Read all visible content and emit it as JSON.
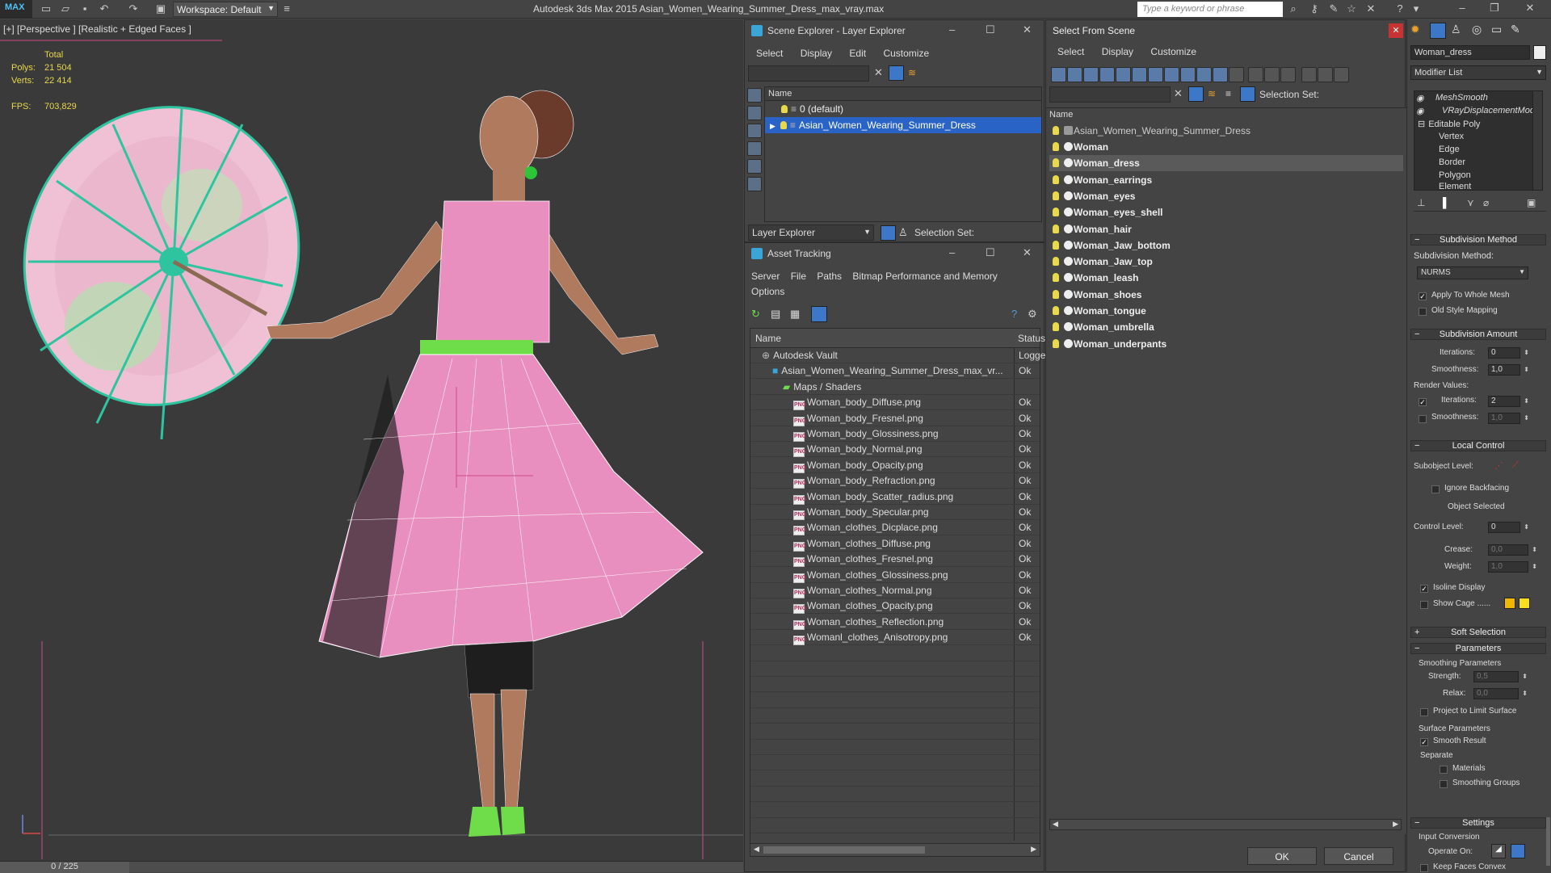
{
  "titlebar": {
    "logo": "MAX",
    "workspace_label": "Workspace: Default",
    "app_title": "Autodesk 3ds Max  2015    Asian_Women_Wearing_Summer_Dress_max_vray.max",
    "search_placeholder": "Type a keyword or phrase"
  },
  "viewport": {
    "label": "[+] [Perspective ] [Realistic + Edged Faces ]",
    "stats": {
      "total_label": "Total",
      "polys_label": "Polys:",
      "polys_value": "21 504",
      "verts_label": "Verts:",
      "verts_value": "22 414",
      "fps_label": "FPS:",
      "fps_value": "703,829"
    },
    "timeline": "0 / 225"
  },
  "scene_explorer": {
    "title": "Scene Explorer - Layer Explorer",
    "menu": [
      "Select",
      "Display",
      "Edit",
      "Customize"
    ],
    "column_name": "Name",
    "rows": [
      "0 (default)",
      "Asian_Women_Wearing_Summer_Dress"
    ],
    "footer_label": "Layer Explorer",
    "selection_set_label": "Selection Set:"
  },
  "asset_tracking": {
    "title": "Asset Tracking",
    "menu": [
      "Server",
      "File",
      "Paths",
      "Bitmap Performance and Memory"
    ],
    "menu2": "Options",
    "col_name": "Name",
    "col_status": "Status",
    "rows": [
      {
        "name": "Autodesk Vault",
        "status": "Logged",
        "indent": 0,
        "type": "vault"
      },
      {
        "name": "Asian_Women_Wearing_Summer_Dress_max_vr...",
        "status": "Ok",
        "indent": 1,
        "type": "max"
      },
      {
        "name": "Maps / Shaders",
        "status": "",
        "indent": 2,
        "type": "folder"
      },
      {
        "name": "Woman_body_Diffuse.png",
        "status": "Ok",
        "indent": 3,
        "type": "png"
      },
      {
        "name": "Woman_body_Fresnel.png",
        "status": "Ok",
        "indent": 3,
        "type": "png"
      },
      {
        "name": "Woman_body_Glossiness.png",
        "status": "Ok",
        "indent": 3,
        "type": "png"
      },
      {
        "name": "Woman_body_Normal.png",
        "status": "Ok",
        "indent": 3,
        "type": "png"
      },
      {
        "name": "Woman_body_Opacity.png",
        "status": "Ok",
        "indent": 3,
        "type": "png"
      },
      {
        "name": "Woman_body_Refraction.png",
        "status": "Ok",
        "indent": 3,
        "type": "png"
      },
      {
        "name": "Woman_body_Scatter_radius.png",
        "status": "Ok",
        "indent": 3,
        "type": "png"
      },
      {
        "name": "Woman_body_Specular.png",
        "status": "Ok",
        "indent": 3,
        "type": "png"
      },
      {
        "name": "Woman_clothes_Dicplace.png",
        "status": "Ok",
        "indent": 3,
        "type": "png"
      },
      {
        "name": "Woman_clothes_Diffuse.png",
        "status": "Ok",
        "indent": 3,
        "type": "png"
      },
      {
        "name": "Woman_clothes_Fresnel.png",
        "status": "Ok",
        "indent": 3,
        "type": "png"
      },
      {
        "name": "Woman_clothes_Glossiness.png",
        "status": "Ok",
        "indent": 3,
        "type": "png"
      },
      {
        "name": "Woman_clothes_Normal.png",
        "status": "Ok",
        "indent": 3,
        "type": "png"
      },
      {
        "name": "Woman_clothes_Opacity.png",
        "status": "Ok",
        "indent": 3,
        "type": "png"
      },
      {
        "name": "Woman_clothes_Reflection.png",
        "status": "Ok",
        "indent": 3,
        "type": "png"
      },
      {
        "name": "Womanl_clothes_Anisotropy.png",
        "status": "Ok",
        "indent": 3,
        "type": "png"
      }
    ]
  },
  "select_from_scene": {
    "title": "Select From Scene",
    "menu": [
      "Select",
      "Display",
      "Customize"
    ],
    "selection_set_label": "Selection Set:",
    "column_name": "Name",
    "group_row": "Asian_Women_Wearing_Summer_Dress",
    "objects": [
      "Woman",
      "Woman_dress",
      "Woman_earrings",
      "Woman_eyes",
      "Woman_eyes_shell",
      "Woman_hair",
      "Woman_Jaw_bottom",
      "Woman_Jaw_top",
      "Woman_leash",
      "Woman_shoes",
      "Woman_tongue",
      "Woman_umbrella",
      "Woman_underpants"
    ],
    "selected": "Woman_dress",
    "ok_label": "OK",
    "cancel_label": "Cancel"
  },
  "command_panel": {
    "object_name": "Woman_dress",
    "modifier_list": "Modifier List",
    "stack": [
      "MeshSmooth",
      "VRayDisplacementMod",
      "Editable Poly",
      "Vertex",
      "Edge",
      "Border",
      "Polygon",
      "Element"
    ],
    "subdivision_method_hdr": "Subdivision Method",
    "subdivision_method_label": "Subdivision Method:",
    "subdivision_method_value": "NURMS",
    "apply_whole_mesh": "Apply To Whole Mesh",
    "old_style_mapping": "Old Style Mapping",
    "subdivision_amount_hdr": "Subdivision Amount",
    "iterations_label": "Iterations:",
    "iterations_value": "0",
    "smoothness_label": "Smoothness:",
    "smoothness_value": "1,0",
    "render_values_label": "Render Values:",
    "render_iterations_value": "2",
    "render_smoothness_value": "1,0",
    "local_control_hdr": "Local Control",
    "subobject_level_label": "Subobject Level:",
    "ignore_backfacing": "Ignore Backfacing",
    "object_selected": "Object Selected",
    "control_level_label": "Control Level:",
    "control_level_value": "0",
    "crease_label": "Crease:",
    "crease_value": "0,0",
    "weight_label": "Weight:",
    "weight_value": "1,0",
    "isoline_display": "Isoline Display",
    "show_cage": "Show Cage ......",
    "soft_selection_hdr": "Soft Selection",
    "parameters_hdr": "Parameters",
    "smoothing_params_label": "Smoothing Parameters",
    "strength_label": "Strength:",
    "strength_value": "0,5",
    "relax_label": "Relax:",
    "relax_value": "0,0",
    "project_limit": "Project to Limit Surface",
    "surface_params_label": "Surface Parameters",
    "smooth_result": "Smooth Result",
    "separate_label": "Separate",
    "materials": "Materials",
    "smoothing_groups": "Smoothing Groups",
    "settings_hdr": "Settings",
    "input_conversion": "Input Conversion",
    "operate_on": "Operate On:",
    "keep_faces_convex": "Keep Faces Convex"
  },
  "colors": {
    "dress_pink": "#e88fc0",
    "skin": "#b07a5e",
    "umbrella_teal": "#2ec4a0",
    "belt_green": "#6fdc4a",
    "selection_blue": "#2a63c6",
    "stats_yellow": "#e8d84a"
  }
}
